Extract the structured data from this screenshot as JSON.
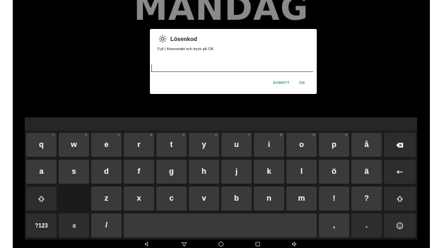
{
  "background": {
    "day_title": "MÅNDAG"
  },
  "dialog": {
    "title": "Lösenkod",
    "message": "Fyll i lösenordet och tryck på OK",
    "input_value": "",
    "cancel_label": "AVBRYT",
    "ok_label": "OK"
  },
  "keyboard": {
    "row1": [
      {
        "label": "q",
        "hint": "1"
      },
      {
        "label": "w",
        "hint": "2"
      },
      {
        "label": "e",
        "hint": "3"
      },
      {
        "label": "r",
        "hint": "4"
      },
      {
        "label": "t",
        "hint": "5"
      },
      {
        "label": "y",
        "hint": "6"
      },
      {
        "label": "u",
        "hint": "7"
      },
      {
        "label": "i",
        "hint": "8"
      },
      {
        "label": "o",
        "hint": "9"
      },
      {
        "label": "p",
        "hint": "0"
      },
      {
        "label": "å",
        "hint": ""
      }
    ],
    "row2": [
      "a",
      "s",
      "d",
      "f",
      "g",
      "h",
      "j",
      "k",
      "l",
      "ö",
      "ä"
    ],
    "row3": [
      "z",
      "x",
      "c",
      "v",
      "b",
      "n",
      "m",
      "!",
      "?"
    ],
    "row4": {
      "symbols": "?123",
      "emoji_label": "☺︎",
      "slash": "/",
      "comma": ",",
      "period": "."
    }
  },
  "colors": {
    "accent": "#26a69a",
    "key": "#3a3a3a",
    "keyboard_bg": "#1b1b1b"
  }
}
